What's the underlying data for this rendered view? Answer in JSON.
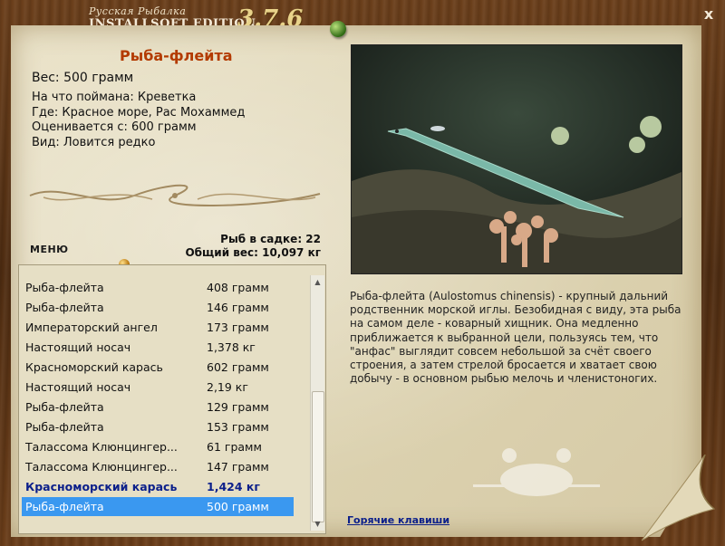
{
  "window": {
    "title_top": "Русская Рыбалка",
    "title_main": "INSTALLSOFT EDITION",
    "version": "3.7.6",
    "close_label": "x"
  },
  "fish": {
    "name": "Рыба-флейта",
    "weight": "Вес: 500 грамм",
    "bait": "На что поймана: Креветка",
    "location": "Где: Красное море, Рас Мохаммед",
    "valued_from": "Оценивается с: 600 грамм",
    "rarity": "Вид: Ловится редко",
    "description": "Рыба-флейта (Aulostomus chinensis) - крупный дальний родственник морской иглы. Безобидная с виду, эта рыба на самом деле - коварный хищник. Она медленно приближается к выбранной цели, пользуясь тем, что \"анфас\" выглядит совсем небольшой за счёт своего строения, а затем стрелой бросается и хватает свою добычу - в основном рыбью мелочь и членистоногих."
  },
  "stats": {
    "fish_in_keepnet": "Рыб в садке: 22",
    "total_weight": "Общий вес: 10,097 кг"
  },
  "menu_label": "МЕНЮ",
  "hotkeys_label": "Горячие клавиши",
  "catch_list": [
    {
      "name": "Рыба-флейта",
      "weight": "408 грамм",
      "style": "normal"
    },
    {
      "name": "Рыба-флейта",
      "weight": "146 грамм",
      "style": "normal"
    },
    {
      "name": "Императорский ангел",
      "weight": "173 грамм",
      "style": "normal"
    },
    {
      "name": "Настоящий носач",
      "weight": "1,378 кг",
      "style": "normal"
    },
    {
      "name": "Красноморский карась",
      "weight": "602 грамм",
      "style": "normal"
    },
    {
      "name": "Настоящий носач",
      "weight": "2,19 кг",
      "style": "normal"
    },
    {
      "name": "Рыба-флейта",
      "weight": "129 грамм",
      "style": "normal"
    },
    {
      "name": "Рыба-флейта",
      "weight": "153 грамм",
      "style": "normal"
    },
    {
      "name": "Талассома Клюнцингер...",
      "weight": "61 грамм",
      "style": "normal"
    },
    {
      "name": "Талассома Клюнцингер...",
      "weight": "147 грамм",
      "style": "normal"
    },
    {
      "name": "Красноморский карась",
      "weight": "1,424 кг",
      "style": "bold"
    },
    {
      "name": "Рыба-флейта",
      "weight": "500 грамм",
      "style": "selected"
    }
  ],
  "colors": {
    "title_red": "#b33a00",
    "selection_blue": "#3a98f0",
    "highlight_navy": "#0b1f8a"
  },
  "icons": {
    "close": "close-icon",
    "pin": "pushpin-icon",
    "scroll_up": "scroll-up-arrow-icon",
    "scroll_down": "scroll-down-arrow-icon"
  }
}
